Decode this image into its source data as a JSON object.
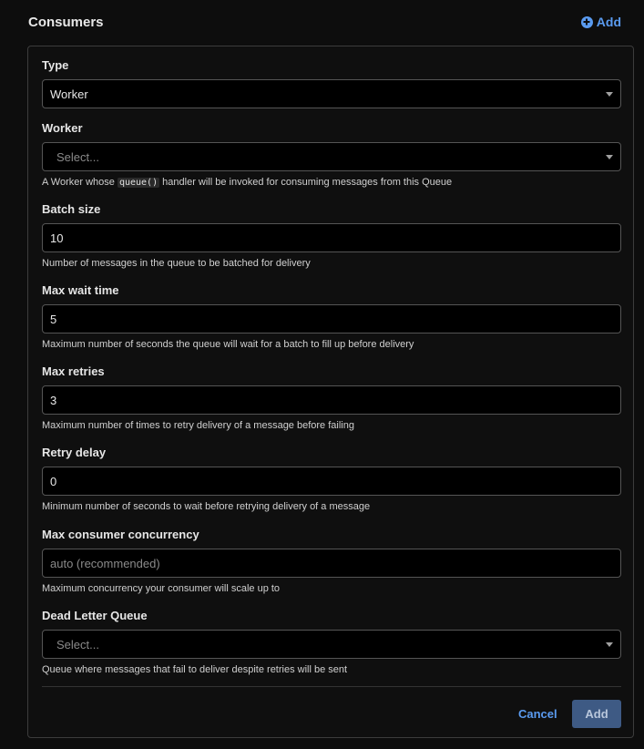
{
  "header": {
    "title": "Consumers",
    "add_label": "Add"
  },
  "fields": {
    "type": {
      "label": "Type",
      "value": "Worker"
    },
    "worker": {
      "label": "Worker",
      "placeholder": "Select...",
      "help_before": "A Worker whose",
      "help_code": "queue()",
      "help_after": "handler will be invoked for consuming messages from this Queue"
    },
    "batch_size": {
      "label": "Batch size",
      "value": "10",
      "help": "Number of messages in the queue to be batched for delivery"
    },
    "max_wait_time": {
      "label": "Max wait time",
      "value": "5",
      "help": "Maximum number of seconds the queue will wait for a batch to fill up before delivery"
    },
    "max_retries": {
      "label": "Max retries",
      "value": "3",
      "help": "Maximum number of times to retry delivery of a message before failing"
    },
    "retry_delay": {
      "label": "Retry delay",
      "value": "0",
      "help": "Minimum number of seconds to wait before retrying delivery of a message"
    },
    "max_concurrency": {
      "label": "Max consumer concurrency",
      "placeholder": "auto (recommended)",
      "help": "Maximum concurrency your consumer will scale up to"
    },
    "dead_letter_queue": {
      "label": "Dead Letter Queue",
      "placeholder": "Select...",
      "help": "Queue where messages that fail to deliver despite retries will be sent"
    }
  },
  "footer": {
    "cancel_label": "Cancel",
    "add_label": "Add"
  },
  "colors": {
    "accent": "#5a9bf0",
    "primary_button": "#3e5a84",
    "background": "#0d0d0d"
  }
}
